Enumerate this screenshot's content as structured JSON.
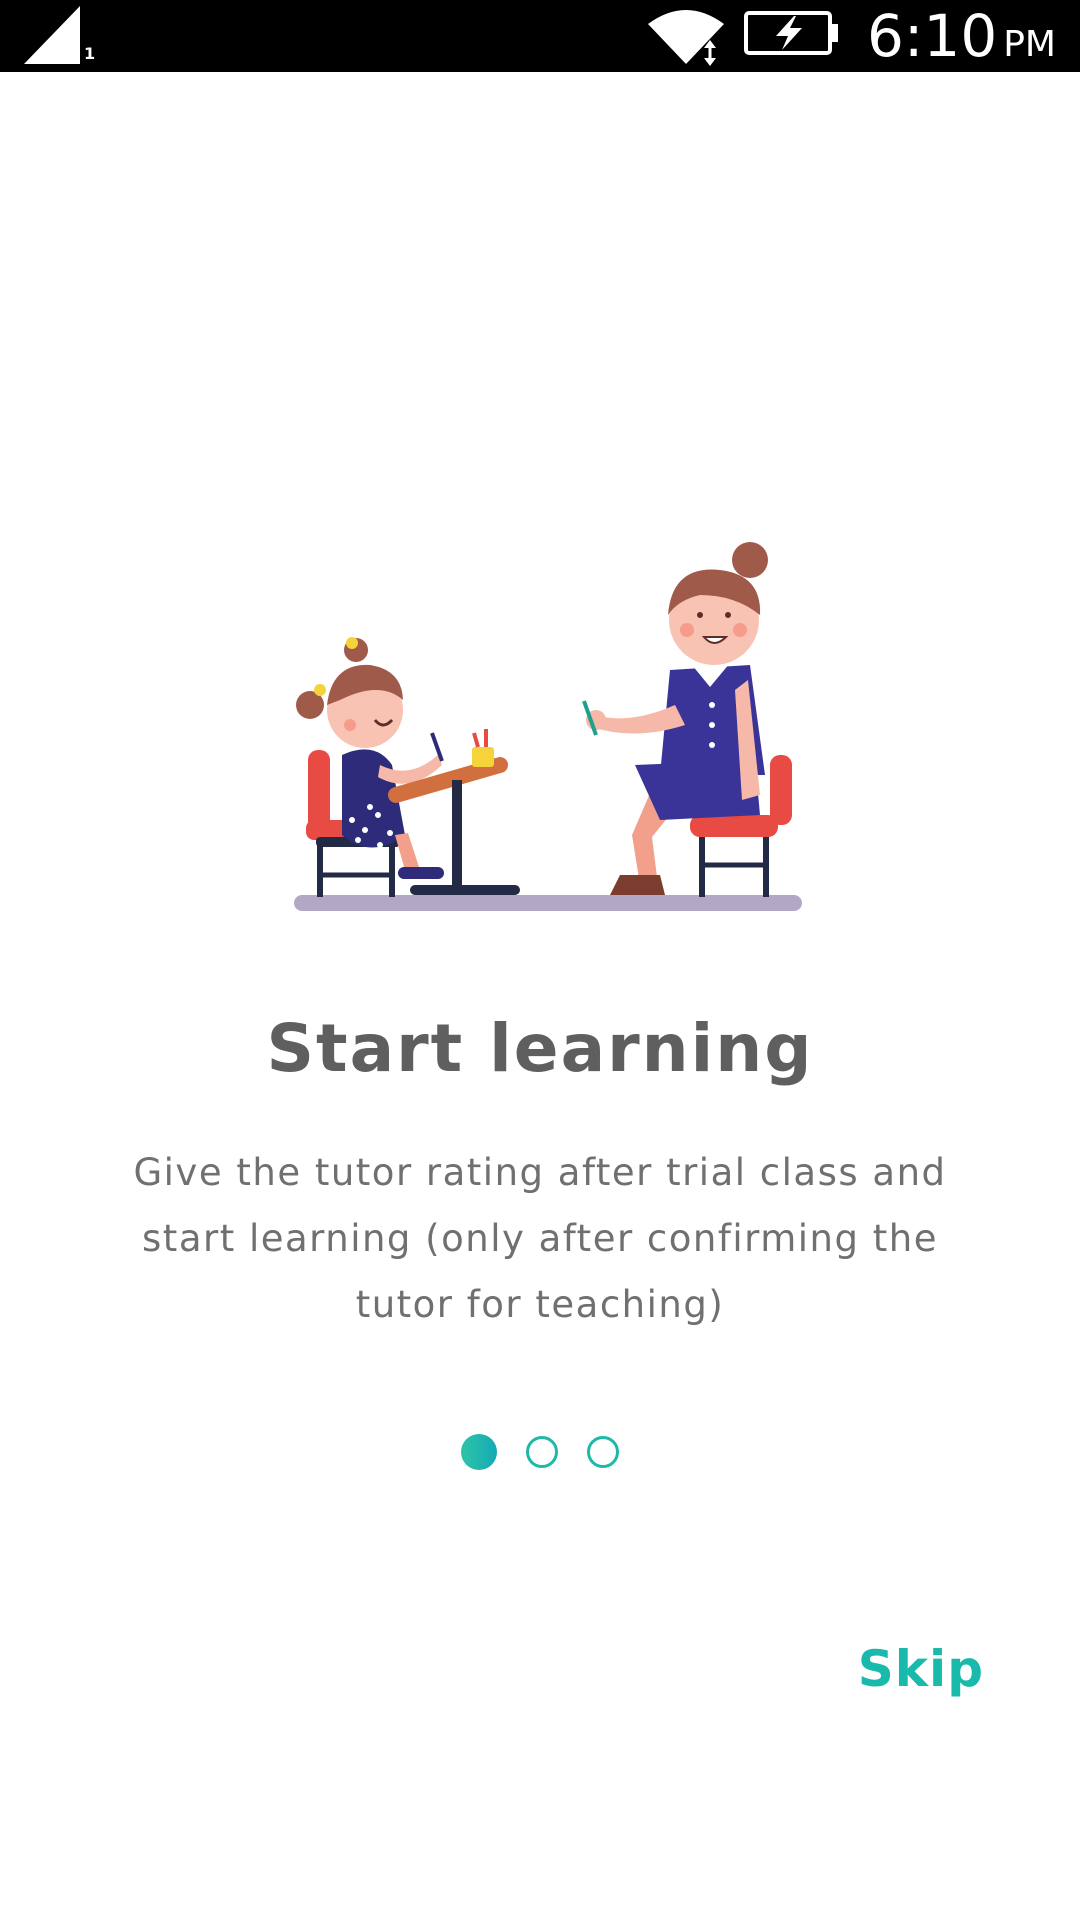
{
  "status_bar": {
    "sim_slot": "1",
    "time": "6:10",
    "ampm": "PM"
  },
  "onboarding": {
    "title": "Start learning",
    "description_lines": [
      "Give the tutor rating after trial class and",
      "start learning (only after confirming the",
      "tutor for teaching)"
    ],
    "page_count": 3,
    "current_page": 1,
    "skip_label": "Skip"
  },
  "colors": {
    "accent": "#19b9ac",
    "title": "#5f5f5f",
    "body_text": "#707070",
    "status_bar_bg": "#000000"
  },
  "icons": {
    "signal": "cell-signal-icon",
    "wifi": "wifi-icon",
    "battery": "battery-charging-icon",
    "illustration": "teacher-student-illustration"
  }
}
